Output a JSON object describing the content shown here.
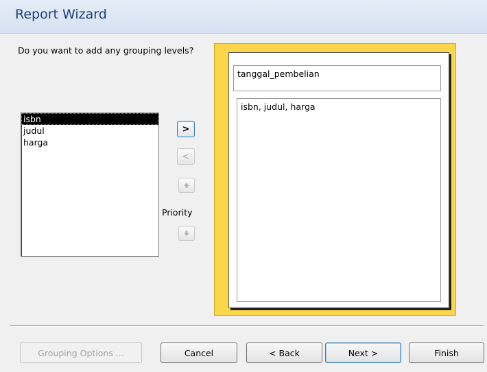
{
  "window": {
    "title": "Report Wizard"
  },
  "prompt": {
    "question": "Do you want to add any grouping levels?"
  },
  "fields_list": {
    "items": [
      {
        "label": "isbn",
        "selected": true
      },
      {
        "label": "judul",
        "selected": false
      },
      {
        "label": "harga",
        "selected": false
      }
    ]
  },
  "controls": {
    "add_label": ">",
    "remove_label": "<",
    "priority_label": "Priority"
  },
  "preview": {
    "group_level": "tanggal_pembelian",
    "detail_fields": "isbn, judul, harga"
  },
  "buttons": {
    "grouping_options": "Grouping Options ...",
    "cancel": "Cancel",
    "back": "< Back",
    "next": "Next >",
    "finish": "Finish"
  },
  "colors": {
    "title_text": "#1f3f78",
    "preview_frame": "#fcd64a",
    "selection": "#000000"
  }
}
